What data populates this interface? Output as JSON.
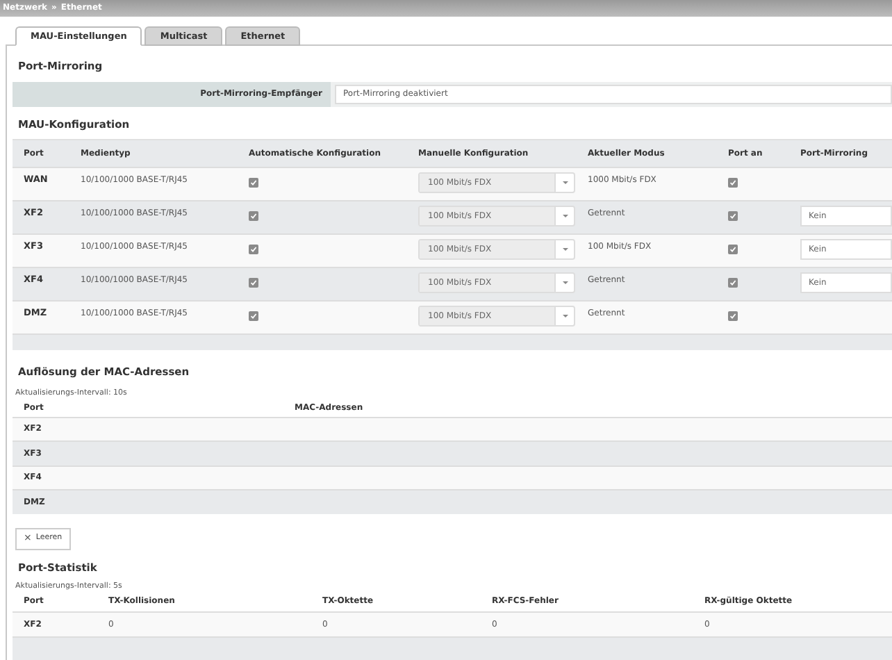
{
  "breadcrumb": [
    "Netzwerk",
    "»",
    "Ethernet"
  ],
  "tabs": [
    {
      "label": "MAU-Einstellungen",
      "selected": true
    },
    {
      "label": "Multicast",
      "selected": false
    },
    {
      "label": "Ethernet",
      "selected": false
    }
  ],
  "port_mirroring": {
    "title": "Port-Mirroring",
    "label": "Port-Mirroring-Empfänger",
    "value": "Port-Mirroring deaktiviert"
  },
  "mau": {
    "title": "MAU-Konfiguration",
    "columns": [
      "Port",
      "Medientyp",
      "Automatische Konfiguration",
      "Manuelle Konfiguration",
      "Aktueller Modus",
      "Port an",
      "Port-Mirroring"
    ],
    "rows": [
      {
        "port": "WAN",
        "media": "10/100/1000 BASE-T/RJ45",
        "auto_config": true,
        "manual": "100 Mbit/s FDX",
        "mode": "1000 Mbit/s FDX",
        "port_on": true
      },
      {
        "port": "XF2",
        "media": "10/100/1000 BASE-T/RJ45",
        "auto_config": true,
        "manual": "100 Mbit/s FDX",
        "mode": "Getrennt",
        "port_on": true,
        "mirroring": "Kein"
      },
      {
        "port": "XF3",
        "media": "10/100/1000 BASE-T/RJ45",
        "auto_config": true,
        "manual": "100 Mbit/s FDX",
        "mode": "100 Mbit/s FDX",
        "port_on": true,
        "mirroring": "Kein"
      },
      {
        "port": "XF4",
        "media": "10/100/1000 BASE-T/RJ45",
        "auto_config": true,
        "manual": "100 Mbit/s FDX",
        "mode": "Getrennt",
        "port_on": true,
        "mirroring": "Kein"
      },
      {
        "port": "DMZ",
        "media": "10/100/1000 BASE-T/RJ45",
        "auto_config": true,
        "manual": "100 Mbit/s FDX",
        "mode": "Getrennt",
        "port_on": true
      }
    ]
  },
  "mac": {
    "title": "Auflösung der MAC-Adressen",
    "interval": "Aktualisierungs-Intervall: 10s",
    "columns": [
      "Port",
      "MAC-Adressen"
    ],
    "rows": [
      "XF2",
      "XF3",
      "XF4",
      "DMZ"
    ],
    "clear_button": {
      "icon": "×",
      "label": "Leeren"
    }
  },
  "stats": {
    "title": "Port-Statistik",
    "interval": "Aktualisierungs-Intervall: 5s",
    "columns": [
      "Port",
      "TX-Kollisionen",
      "TX-Oktette",
      "RX-FCS-Fehler",
      "RX-gültige Oktette"
    ],
    "rows": [
      [
        "XF2",
        "0",
        "0",
        "0",
        "0"
      ]
    ]
  }
}
